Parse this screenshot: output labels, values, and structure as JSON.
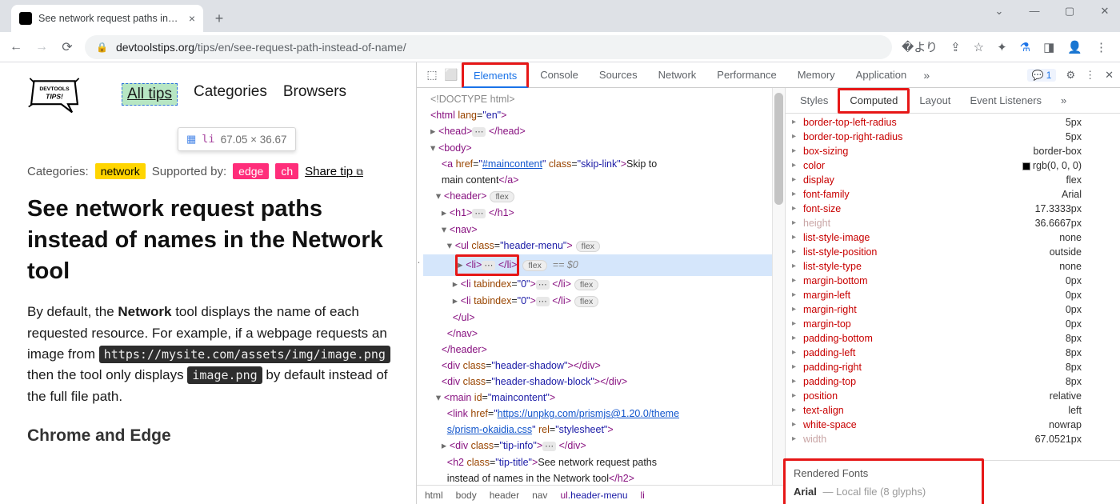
{
  "browser_tab": {
    "title": "See network request paths instea"
  },
  "url": {
    "domain": "devtoolstips.org",
    "path": "/tips/en/see-request-path-instead-of-name/"
  },
  "page": {
    "logo_text": "DEVTOOLS TIPS!",
    "nav": {
      "all_tips": "All tips",
      "categories": "Categories",
      "browsers": "Browsers"
    },
    "inspect_tooltip": {
      "element": "li",
      "dimensions": "67.05 × 36.67"
    },
    "meta": {
      "categories_label": "Categories:",
      "network": "network",
      "supported_label": "Supported by:",
      "edge": "edge",
      "ch": "ch",
      "share": "Share tip"
    },
    "title": "See network request paths instead of names in the Network tool",
    "para_prefix": "By default, the ",
    "para_bold1": "Network",
    "para_mid1": " tool displays the name of each requested resource. For example, if a webpage requests an image from ",
    "code1": "https://mysite.com/assets/img/image.png",
    "para_mid2": " then the tool only displays ",
    "code2": "image.png",
    "para_end": " by default instead of the full file path.",
    "subhead": "Chrome and Edge"
  },
  "devtools": {
    "tabs": [
      "Elements",
      "Console",
      "Sources",
      "Network",
      "Performance",
      "Memory",
      "Application"
    ],
    "msg_count": "1",
    "side_tabs": [
      "Styles",
      "Computed",
      "Layout",
      "Event Listeners"
    ],
    "dom": {
      "doctype": "<!DOCTYPE html>",
      "skip_text": "Skip to main content",
      "link_href": "https://unpkg.com/prismjs@1.20.0/themes/prism-okaidia.css",
      "h2_text": "See network request paths instead of names in the Network tool",
      "sel_suffix": " == $0"
    },
    "crumbs": [
      "html",
      "body",
      "header",
      "nav",
      "ul.header-menu",
      "li"
    ],
    "props": [
      {
        "n": "border-top-left-radius",
        "v": "5px"
      },
      {
        "n": "border-top-right-radius",
        "v": "5px"
      },
      {
        "n": "box-sizing",
        "v": "border-box"
      },
      {
        "n": "color",
        "v": "rgb(0, 0, 0)",
        "swatch": true
      },
      {
        "n": "display",
        "v": "flex"
      },
      {
        "n": "font-family",
        "v": "Arial"
      },
      {
        "n": "font-size",
        "v": "17.3333px"
      },
      {
        "n": "height",
        "v": "36.6667px",
        "dim": true
      },
      {
        "n": "list-style-image",
        "v": "none"
      },
      {
        "n": "list-style-position",
        "v": "outside"
      },
      {
        "n": "list-style-type",
        "v": "none"
      },
      {
        "n": "margin-bottom",
        "v": "0px"
      },
      {
        "n": "margin-left",
        "v": "0px"
      },
      {
        "n": "margin-right",
        "v": "0px"
      },
      {
        "n": "margin-top",
        "v": "0px"
      },
      {
        "n": "padding-bottom",
        "v": "8px"
      },
      {
        "n": "padding-left",
        "v": "8px"
      },
      {
        "n": "padding-right",
        "v": "8px"
      },
      {
        "n": "padding-top",
        "v": "8px"
      },
      {
        "n": "position",
        "v": "relative"
      },
      {
        "n": "text-align",
        "v": "left"
      },
      {
        "n": "white-space",
        "v": "nowrap"
      },
      {
        "n": "width",
        "v": "67.0521px",
        "dim": true
      }
    ],
    "rendered_fonts": {
      "label": "Rendered Fonts",
      "name": "Arial",
      "source": "Local file",
      "glyphs": "(8 glyphs)"
    }
  }
}
